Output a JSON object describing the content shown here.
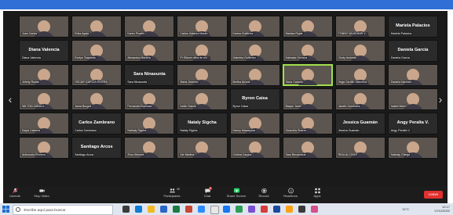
{
  "toolbar": {
    "unmute_label": "Unmute",
    "stop_video_label": "Stop Video",
    "participants_label": "Participants",
    "participants_count": "40",
    "chat_label": "Chat",
    "chat_badge": "5",
    "share_screen_label": "Share Screen",
    "record_label": "Record",
    "reactions_label": "Reactions",
    "apps_label": "Apps",
    "leave_label": "Leave"
  },
  "taskbar": {
    "search_placeholder": "Escribe aquí para buscar",
    "weather": "11°C",
    "clock_time": "12:17",
    "clock_date": "17/12/2022"
  },
  "colors": {
    "share_screen": "#2ad36c",
    "leave": "#e0312f",
    "active_speaker": "#9fe04b",
    "topbar": "#2f6fd6"
  },
  "tiles": [
    {
      "name": "Juan Carlos",
      "big": "",
      "video": true
    },
    {
      "name": "Erika Ayala",
      "big": "",
      "video": true
    },
    {
      "name": "Karen Proaño",
      "big": "",
      "video": true
    },
    {
      "name": "Carlos Galarza Morán",
      "big": "",
      "video": true
    },
    {
      "name": "Karina Gutiérrez",
      "big": "",
      "video": true
    },
    {
      "name": "Maritza Rojas",
      "big": "",
      "video": true
    },
    {
      "name": "TONNY WLADIMIR V...",
      "big": "",
      "video": true
    },
    {
      "name": "Mariela Palacios",
      "big": "Mariela Palacios",
      "video": false
    },
    {
      "name": "Diana Valencia",
      "big": "Diana Valencia",
      "video": false
    },
    {
      "name": "Evelyn Toapanta",
      "big": "",
      "video": true
    },
    {
      "name": "Alexandra Mantilla",
      "big": "",
      "video": true
    },
    {
      "name": "Pr Eliezer silva de sin...",
      "big": "",
      "video": true
    },
    {
      "name": "Gabriela Gutiérrez",
      "big": "",
      "video": true
    },
    {
      "name": "Katiuska Ormaza",
      "big": "",
      "video": true
    },
    {
      "name": "Cindy Andrade",
      "big": "",
      "video": true
    },
    {
      "name": "Daniela García",
      "big": "Daniela García",
      "video": false
    },
    {
      "name": "Jeferly Rodas",
      "big": "",
      "video": true
    },
    {
      "name": "OSCAR GARCIA RIVERA",
      "big": "",
      "video": true
    },
    {
      "name": "Sara Ninasunta",
      "big": "Sara Ninasunta",
      "video": false
    },
    {
      "name": "Maria Jiménez",
      "big": "",
      "video": true
    },
    {
      "name": "Bertha Alcívar",
      "big": "",
      "video": true
    },
    {
      "name": "Tania Caicedo",
      "big": "",
      "video": true
    },
    {
      "name": "Vega Carrillo Valentina",
      "big": "",
      "video": true
    },
    {
      "name": "Daniela Narvaez",
      "big": "",
      "video": true
    },
    {
      "name": "WILTON ZABALA",
      "big": "",
      "video": true
    },
    {
      "name": "Jama Burgos",
      "big": "",
      "video": true
    },
    {
      "name": "Fernanda Espinosa",
      "big": "",
      "video": true
    },
    {
      "name": "Ivette Garcia",
      "big": "",
      "video": true
    },
    {
      "name": "Byron Caisa",
      "big": "Byron Caisa",
      "video": false
    },
    {
      "name": "Baque Janet",
      "big": "",
      "video": true
    },
    {
      "name": "Janeth Zambrano",
      "big": "",
      "video": true
    },
    {
      "name": "Isabel Merlo",
      "big": "",
      "video": true
    },
    {
      "name": "Kayla Cabrera",
      "big": "",
      "video": true
    },
    {
      "name": "Carlos Zambrano",
      "big": "Carlos Zambrano",
      "video": false
    },
    {
      "name": "Nathaly Sigcha",
      "big": "",
      "video": true
    },
    {
      "name": "Nataly Sigcha",
      "big": "Nataly Sigcha",
      "video": false
    },
    {
      "name": "Danny Masaquiza",
      "big": "",
      "video": true
    },
    {
      "name": "Geanella Suarez",
      "big": "",
      "video": true
    },
    {
      "name": "Jessica Guamán",
      "big": "Jessica Guamán",
      "video": false
    },
    {
      "name": "Angy Peralta V.",
      "big": "Angy Peralta V.",
      "video": false
    },
    {
      "name": "Anthonela Romero",
      "big": "",
      "video": true
    },
    {
      "name": "Santiago Arcos",
      "big": "Santiago Arcos",
      "video": false
    },
    {
      "name": "Zhou Briones",
      "big": "",
      "video": true
    },
    {
      "name": "Ale Medina",
      "big": "",
      "video": true
    },
    {
      "name": "Cinthia Cargua",
      "big": "",
      "video": true
    },
    {
      "name": "Saul Benalcázar",
      "big": "",
      "video": true
    },
    {
      "name": "RIDA ALCIVAR",
      "big": "",
      "video": true
    },
    {
      "name": "Nathaly Ortega",
      "big": "",
      "video": true
    }
  ]
}
